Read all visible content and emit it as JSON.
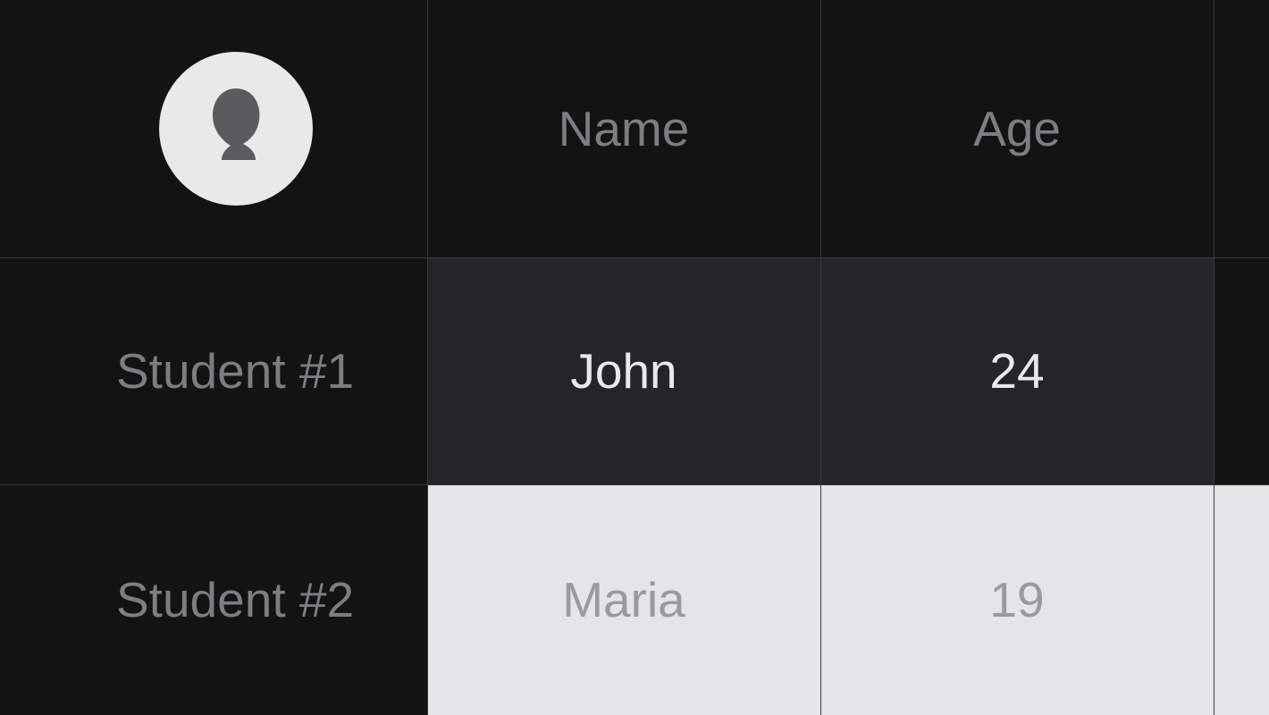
{
  "table": {
    "headers": {
      "name": "Name",
      "age": "Age"
    },
    "rows": [
      {
        "label": "Student #1",
        "name": "John",
        "age": "24",
        "variant": "dark"
      },
      {
        "label": "Student #2",
        "name": "Maria",
        "age": "19",
        "variant": "light"
      }
    ]
  }
}
